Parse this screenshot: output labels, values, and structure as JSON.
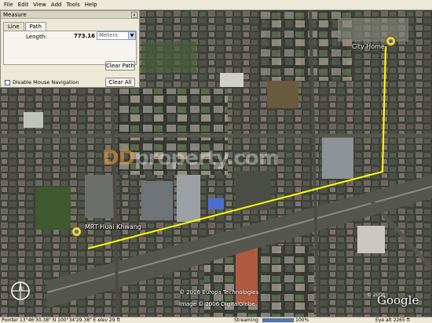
{
  "menu": {
    "items": [
      "File",
      "Edit",
      "View",
      "Add",
      "Tools",
      "Help"
    ]
  },
  "measure_panel": {
    "title": "Measure",
    "close_glyph": "x",
    "tabs": [
      "Line",
      "Path"
    ],
    "active_tab": "Path",
    "length_label": "Length:",
    "length_value": "773.16",
    "unit_selected": "Meters",
    "clear_path_label": "Clear Path",
    "disable_mouse_label": "Disable Mouse Navigation",
    "clear_all_label": "Clear All"
  },
  "map": {
    "placemarks": {
      "home": "City Home",
      "mrt": "MRT Huai Khwang"
    },
    "watermark": {
      "prefix": "DD",
      "rest": "property.com"
    },
    "copyright": [
      "© 2006 Europa Technologies",
      "Image © 2006 DigitalGlobe"
    ],
    "year_mark": "© 2006",
    "logo_text": "Google",
    "path_color": "#ffff00",
    "pin_color": "#f4d13a"
  },
  "status": {
    "pointer": "Pointer  13°46'30.38\" N  100°34'29.38\" E   elev   29 ft",
    "streaming": "Streaming",
    "percent": "100%",
    "streaming_fraction": 1.0,
    "eye": "Eye alt   2265 ft"
  }
}
